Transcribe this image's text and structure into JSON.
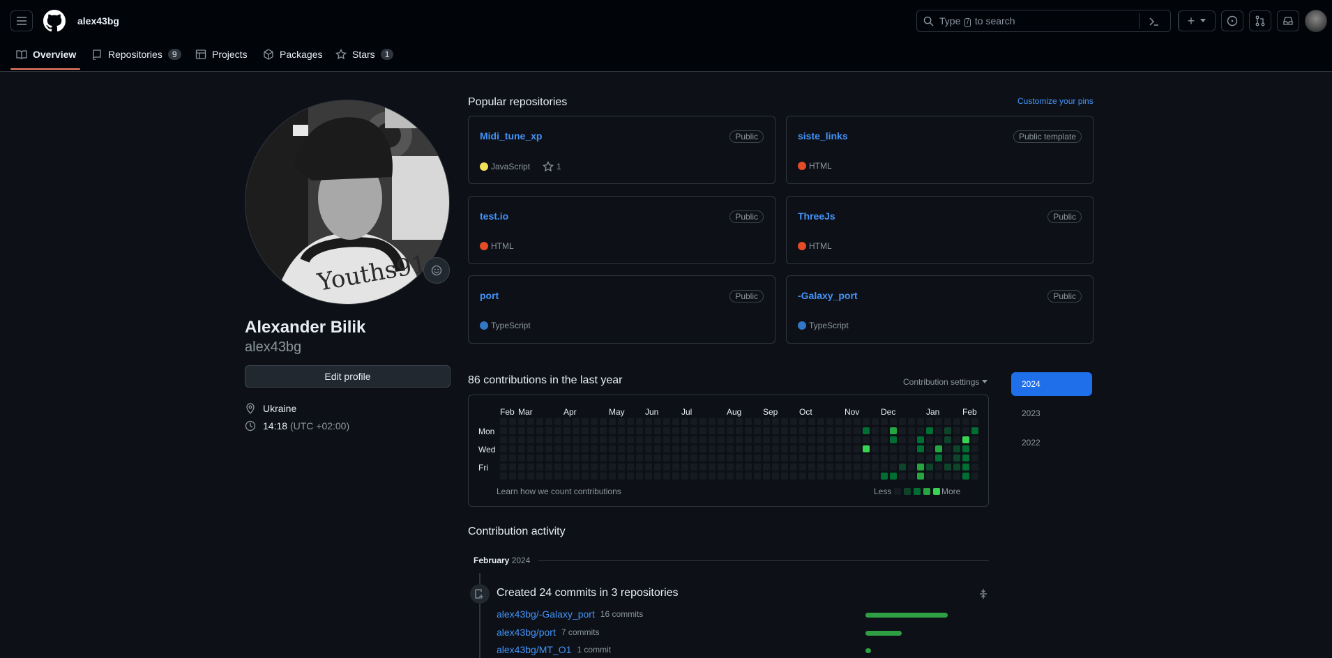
{
  "header": {
    "username": "alex43bg",
    "search_placeholder_before": "Type",
    "search_key": "/",
    "search_placeholder_after": "to search",
    "plus_label": "+",
    "icons": [
      "hamburger-icon",
      "github-logo-icon",
      "search-icon",
      "command-palette-icon",
      "plus-icon",
      "chevron-down-icon",
      "issues-icon",
      "pull-requests-icon",
      "inbox-icon",
      "avatar"
    ]
  },
  "tabs": [
    {
      "label": "Overview",
      "count": ""
    },
    {
      "label": "Repositories",
      "count": "9"
    },
    {
      "label": "Projects",
      "count": ""
    },
    {
      "label": "Packages",
      "count": ""
    },
    {
      "label": "Stars",
      "count": "1"
    }
  ],
  "profile": {
    "full_name": "Alexander Bilik",
    "username": "alex43bg",
    "edit_label": "Edit profile",
    "location": "Ukraine",
    "time": "14:18",
    "timezone": "(UTC +02:00)"
  },
  "popular": {
    "title": "Popular repositories",
    "customize": "Customize your pins",
    "repos": [
      {
        "name": "Midi_tune_xp",
        "visibility": "Public",
        "language": "JavaScript",
        "lang_color": "#f1e05a",
        "stars": "1"
      },
      {
        "name": "siste_links",
        "visibility": "Public template",
        "language": "HTML",
        "lang_color": "#e34c26",
        "stars": ""
      },
      {
        "name": "test.io",
        "visibility": "Public",
        "language": "HTML",
        "lang_color": "#e34c26",
        "stars": ""
      },
      {
        "name": "ThreeJs",
        "visibility": "Public",
        "language": "HTML",
        "lang_color": "#e34c26",
        "stars": ""
      },
      {
        "name": "port",
        "visibility": "Public",
        "language": "TypeScript",
        "lang_color": "#3178c6",
        "stars": ""
      },
      {
        "name": "-Galaxy_port",
        "visibility": "Public",
        "language": "TypeScript",
        "lang_color": "#3178c6",
        "stars": ""
      }
    ]
  },
  "contributions": {
    "title": "86 contributions in the last year",
    "settings": "Contribution settings",
    "months": [
      "Feb",
      "Mar",
      "Apr",
      "May",
      "Jun",
      "Jul",
      "Aug",
      "Sep",
      "Oct",
      "Nov",
      "Dec",
      "Jan",
      "Feb"
    ],
    "days": [
      "Mon",
      "Wed",
      "Fri"
    ],
    "learn": "Learn how we count contributions",
    "less": "Less",
    "more": "More",
    "active_cells": [
      {
        "week": 40,
        "day": 1,
        "level": 2
      },
      {
        "week": 40,
        "day": 3,
        "level": 4
      },
      {
        "week": 42,
        "day": 6,
        "level": 2
      },
      {
        "week": 43,
        "day": 1,
        "level": 3
      },
      {
        "week": 43,
        "day": 2,
        "level": 2
      },
      {
        "week": 43,
        "day": 6,
        "level": 2
      },
      {
        "week": 44,
        "day": 5,
        "level": 1
      },
      {
        "week": 46,
        "day": 2,
        "level": 2
      },
      {
        "week": 46,
        "day": 3,
        "level": 2
      },
      {
        "week": 46,
        "day": 5,
        "level": 3
      },
      {
        "week": 46,
        "day": 6,
        "level": 3
      },
      {
        "week": 47,
        "day": 1,
        "level": 2
      },
      {
        "week": 47,
        "day": 5,
        "level": 1
      },
      {
        "week": 48,
        "day": 3,
        "level": 3
      },
      {
        "week": 48,
        "day": 4,
        "level": 2
      },
      {
        "week": 49,
        "day": 1,
        "level": 1
      },
      {
        "week": 49,
        "day": 2,
        "level": 1
      },
      {
        "week": 49,
        "day": 5,
        "level": 1
      },
      {
        "week": 50,
        "day": 3,
        "level": 1
      },
      {
        "week": 50,
        "day": 4,
        "level": 1
      },
      {
        "week": 50,
        "day": 5,
        "level": 1
      },
      {
        "week": 51,
        "day": 2,
        "level": 4
      },
      {
        "week": 51,
        "day": 3,
        "level": 2
      },
      {
        "week": 51,
        "day": 4,
        "level": 2
      },
      {
        "week": 51,
        "day": 5,
        "level": 2
      },
      {
        "week": 51,
        "day": 6,
        "level": 2
      },
      {
        "week": 52,
        "day": 1,
        "level": 2
      }
    ],
    "level_colors": [
      "#161b22",
      "#0e4429",
      "#006d32",
      "#26a641",
      "#39d353"
    ]
  },
  "years": [
    "2024",
    "2023",
    "2022"
  ],
  "activity": {
    "title": "Contribution activity",
    "month": "February",
    "year": "2024",
    "summary": "Created 24 commits in 3 repositories",
    "repos": [
      {
        "name": "alex43bg/-Galaxy_port",
        "commits": "16 commits",
        "fraction": 1.0
      },
      {
        "name": "alex43bg/port",
        "commits": "7 commits",
        "fraction": 0.44
      },
      {
        "name": "alex43bg/MT_O1",
        "commits": "1 commit",
        "fraction": 0.06
      }
    ]
  }
}
